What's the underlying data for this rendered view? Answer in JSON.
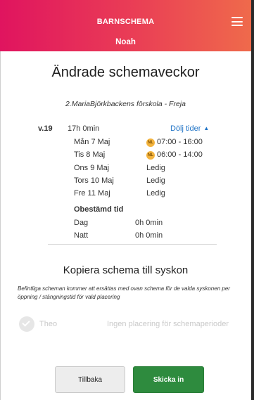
{
  "header": {
    "app_title": "BARNSCHEMA",
    "child_name": "Noah",
    "menu_icon": "hamburger-menu-icon",
    "gradient_colors": [
      "#e0145f",
      "#ef6a4b"
    ]
  },
  "page": {
    "title": "Ändrade schemaveckor",
    "placement": "2.MariaBjörkbackens förskola - Freja"
  },
  "week": {
    "label": "v.19",
    "hours": "17h 0min",
    "toggle_label": "Dölj tider",
    "toggle_caret": "▲",
    "days": [
      {
        "day": "Mån 7 Maj",
        "badge": "NL",
        "value": "07:00 - 16:00"
      },
      {
        "day": "Tis 8 Maj",
        "badge": "NL",
        "value": "06:00 - 14:00"
      },
      {
        "day": "Ons 9 Maj",
        "badge": "",
        "value": "Ledig"
      },
      {
        "day": "Tors 10 Maj",
        "badge": "",
        "value": "Ledig"
      },
      {
        "day": "Fre 11 Maj",
        "badge": "",
        "value": "Ledig"
      }
    ],
    "undetermined_label": "Obestämd tid",
    "undetermined": [
      {
        "label": "Dag",
        "value": "0h 0min"
      },
      {
        "label": "Natt",
        "value": "0h 0min"
      }
    ]
  },
  "copy": {
    "title": "Kopiera schema till syskon",
    "note": "Befintliga scheman kommer att ersättas med ovan schema för de valda syskonen per öppning / stängningstid för vald placering",
    "siblings": [
      {
        "name": "Theo",
        "status": "Ingen placering för schemaperioder",
        "checked": false
      }
    ]
  },
  "buttons": {
    "back": "Tillbaka",
    "submit": "Skicka in"
  },
  "colors": {
    "link": "#1f73c6",
    "badge": "#f3b33d",
    "submit": "#2e8b3e",
    "disabled_text": "#c9c9c9"
  }
}
